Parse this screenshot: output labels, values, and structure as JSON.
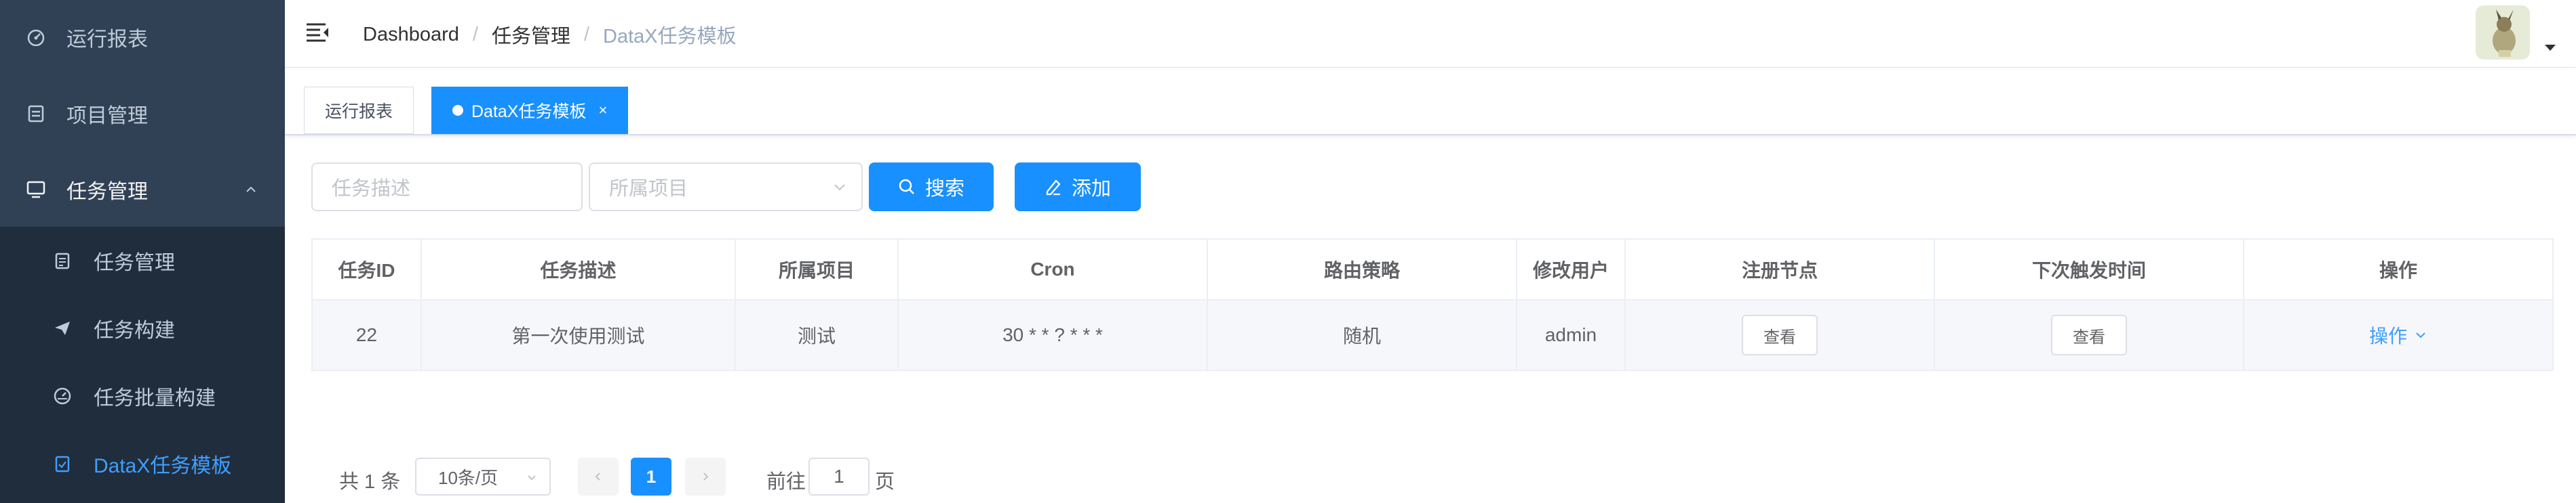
{
  "sidebar": {
    "items": [
      {
        "label": "运行报表",
        "icon": "dashboard-icon"
      },
      {
        "label": "项目管理",
        "icon": "project-icon"
      },
      {
        "label": "任务管理",
        "icon": "monitor-icon"
      }
    ],
    "submenu": [
      {
        "label": "任务管理",
        "icon": "task-icon"
      },
      {
        "label": "任务构建",
        "icon": "send-icon"
      },
      {
        "label": "任务批量构建",
        "icon": "batch-icon"
      },
      {
        "label": "DataX任务模板",
        "icon": "template-icon",
        "active": true
      }
    ]
  },
  "navbar": {
    "breadcrumb": [
      "Dashboard",
      "任务管理",
      "DataX任务模板"
    ]
  },
  "tags": [
    {
      "label": "运行报表",
      "active": false
    },
    {
      "label": "DataX任务模板",
      "active": true,
      "close": "×"
    }
  ],
  "filters": {
    "desc_placeholder": "任务描述",
    "project_placeholder": "所属项目",
    "search_label": "搜索",
    "add_label": "添加"
  },
  "table": {
    "columns": [
      "任务ID",
      "任务描述",
      "所属项目",
      "Cron",
      "路由策略",
      "修改用户",
      "注册节点",
      "下次触发时间",
      "操作"
    ],
    "rows": [
      {
        "id": "22",
        "desc": "第一次使用测试",
        "project": "测试",
        "cron": "30 * * ? * * *",
        "route": "随机",
        "user": "admin",
        "node_btn": "查看",
        "next_btn": "查看",
        "op": "操作"
      }
    ]
  },
  "pagination": {
    "total_text": "共 1 条",
    "page_size": "10条/页",
    "current_page": "1",
    "goto_prefix": "前往",
    "goto_value": "1",
    "goto_suffix": "页"
  },
  "colors": {
    "sidebar_bg": "#304156",
    "submenu_bg": "#1f2d3d",
    "accent": "#1890ff",
    "active_link": "#409eff"
  }
}
